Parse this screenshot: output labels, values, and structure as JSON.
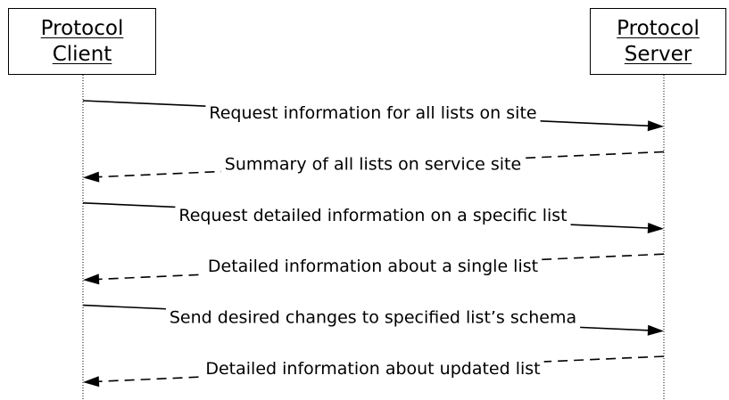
{
  "participants": {
    "client": {
      "line1": "Protocol",
      "line2": "Client"
    },
    "server": {
      "line1": "Protocol",
      "line2": "Server"
    }
  },
  "messages": [
    {
      "text": "Request information for all lists on site",
      "from": "client",
      "to": "server",
      "style": "solid"
    },
    {
      "text": "Summary of all lists on service site",
      "from": "server",
      "to": "client",
      "style": "dashed"
    },
    {
      "text": "Request detailed information on a specific list",
      "from": "client",
      "to": "server",
      "style": "solid"
    },
    {
      "text": "Detailed information about a single list",
      "from": "server",
      "to": "client",
      "style": "dashed"
    },
    {
      "text": "Send desired changes to specified list’s schema",
      "from": "client",
      "to": "server",
      "style": "solid"
    },
    {
      "text": "Detailed information about updated list",
      "from": "server",
      "to": "client",
      "style": "dashed"
    }
  ]
}
